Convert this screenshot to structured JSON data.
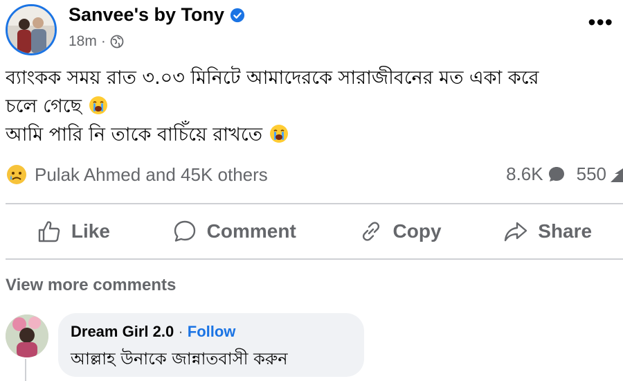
{
  "post": {
    "author": "Sanvee's by Tony",
    "time": "18m",
    "text_line1": "ব্যাংকক সময় রাত ৩.০৩ মিনিটে আমাদেরকে সারাজীবনের মত একা করে",
    "text_line2": "চলে গেছে",
    "text_line3": "আমি পারি নি তাকে বাচিঁয়ে রাখতে"
  },
  "reactions": {
    "summary": "Pulak Ahmed and 45K others",
    "comments_count": "8.6K",
    "shares_count": "550"
  },
  "actions": {
    "like": "Like",
    "comment": "Comment",
    "copy": "Copy",
    "share": "Share"
  },
  "comments": {
    "view_more": "View more comments",
    "items": [
      {
        "author": "Dream Girl 2.0",
        "separator": "·",
        "follow": "Follow",
        "text": "আল্লাহ উনাকে জান্নাতবাসী করুন"
      }
    ]
  },
  "colors": {
    "accent": "#1b74e4",
    "muted_text": "#65676b",
    "divider": "#ced0d4",
    "bubble": "#f0f2f5"
  },
  "icons": {
    "verified": "verified-badge-icon",
    "globe": "globe-icon",
    "more": "more-options-icon",
    "sad_reaction": "sad-reaction-icon",
    "crying_emoji": "loudly-crying-emoji"
  }
}
